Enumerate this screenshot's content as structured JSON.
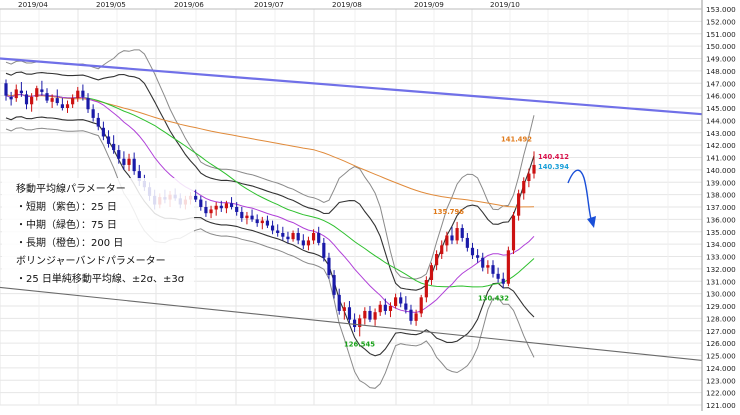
{
  "chart_data": {
    "type": "candlestick",
    "instrument_note": "",
    "x_axis": {
      "labels": [
        "2019/04",
        "2019/05",
        "2019/06",
        "2019/07",
        "2019/08",
        "2019/09",
        "2019/10"
      ]
    },
    "y_axis": {
      "range": [
        121.0,
        153.0
      ],
      "tick_step": 1.0,
      "tick_labels": [
        "153.000",
        "152.000",
        "151.000",
        "150.000",
        "149.000",
        "148.000",
        "147.000",
        "146.000",
        "145.000",
        "144.000",
        "143.000",
        "142.000",
        "141.000",
        "140.000",
        "139.000",
        "138.000",
        "137.000",
        "136.000",
        "135.000",
        "134.000",
        "133.000",
        "132.000",
        "131.000",
        "130.000",
        "129.000",
        "128.000",
        "127.000",
        "126.000",
        "125.000",
        "124.000",
        "123.000",
        "122.000",
        "121.000"
      ],
      "grid": true
    },
    "legend_text": {
      "ma_title": "移動平均線パラメーター",
      "ma_short": "・短期（紫色）：25 日",
      "ma_mid": "・中期（緑色）：75 日",
      "ma_long": "・長期（橙色）：200 日",
      "bb_title": "ボリンジャーバンドパラメーター",
      "bb_desc": "・25 日単純移動平均線、±2σ、±3σ"
    },
    "annotations": [
      {
        "text": "126.545",
        "price": 126.545,
        "color": "#1aa31a"
      },
      {
        "text": "135.796",
        "price": 135.796,
        "color": "#e07a1a"
      },
      {
        "text": "130.432",
        "price": 130.432,
        "color": "#1aa31a"
      },
      {
        "text": "141.492",
        "price": 141.492,
        "color": "#e07a1a"
      },
      {
        "text": "140.412",
        "price": 140.412,
        "color": "#d8124a"
      },
      {
        "text": "140.394",
        "price": 140.394,
        "color": "#1a9fd8"
      }
    ],
    "series_colors": {
      "up_candle": "#cc1111",
      "down_candle": "#1a1aa8",
      "ma_short": "#b040d8",
      "ma_mid": "#2ec02e",
      "ma_long": "#e08a3a",
      "bb_mid": "#333333",
      "bb_outer": "#8a8a8a",
      "trend_upper": "#7070e8",
      "trend_lower": "#6a6a6a",
      "forecast_arrow": "#1a4fd8"
    },
    "candles": [
      [
        147.0,
        147.3,
        145.6,
        146.0
      ],
      [
        145.9,
        146.3,
        145.2,
        145.7
      ],
      [
        145.8,
        146.9,
        145.5,
        146.5
      ],
      [
        146.4,
        147.1,
        145.9,
        146.2
      ],
      [
        146.1,
        146.4,
        144.9,
        145.3
      ],
      [
        145.3,
        146.2,
        144.7,
        145.9
      ],
      [
        145.9,
        146.8,
        145.6,
        146.6
      ],
      [
        146.5,
        147.2,
        146.0,
        146.3
      ],
      [
        146.2,
        146.6,
        145.4,
        145.6
      ],
      [
        145.5,
        146.1,
        145.0,
        145.8
      ],
      [
        145.8,
        146.5,
        145.2,
        145.4
      ],
      [
        145.3,
        145.8,
        144.8,
        145.0
      ],
      [
        145.0,
        145.6,
        144.6,
        145.3
      ],
      [
        145.3,
        146.1,
        145.0,
        145.8
      ],
      [
        145.8,
        146.7,
        145.5,
        146.4
      ],
      [
        146.4,
        146.9,
        145.6,
        145.9
      ],
      [
        145.8,
        146.2,
        144.6,
        144.9
      ],
      [
        144.9,
        145.3,
        143.9,
        144.2
      ],
      [
        144.2,
        144.6,
        143.2,
        143.5
      ],
      [
        143.4,
        143.9,
        142.4,
        142.7
      ],
      [
        142.7,
        143.2,
        141.8,
        142.1
      ],
      [
        142.1,
        142.8,
        141.3,
        141.6
      ],
      [
        141.6,
        142.0,
        140.5,
        140.9
      ],
      [
        140.9,
        141.5,
        140.0,
        140.4
      ],
      [
        140.4,
        141.3,
        139.9,
        140.9
      ],
      [
        140.9,
        141.4,
        139.6,
        139.9
      ],
      [
        139.9,
        140.4,
        138.7,
        139.1
      ],
      [
        139.1,
        139.6,
        138.3,
        138.6
      ],
      [
        138.6,
        139.0,
        137.5,
        137.9
      ],
      [
        137.9,
        138.4,
        136.8,
        137.2
      ],
      [
        137.2,
        138.1,
        136.9,
        137.8
      ],
      [
        137.8,
        138.4,
        137.3,
        137.6
      ],
      [
        137.6,
        138.3,
        137.0,
        138.0
      ],
      [
        138.0,
        138.5,
        137.5,
        137.7
      ],
      [
        137.7,
        138.1,
        136.9,
        137.2
      ],
      [
        137.2,
        137.9,
        136.8,
        137.6
      ],
      [
        137.6,
        138.2,
        137.2,
        137.9
      ],
      [
        137.9,
        138.4,
        137.4,
        137.6
      ],
      [
        137.6,
        137.9,
        136.7,
        137.0
      ],
      [
        137.0,
        137.5,
        136.2,
        136.5
      ],
      [
        136.5,
        137.1,
        136.1,
        136.8
      ],
      [
        136.8,
        137.4,
        136.3,
        137.1
      ],
      [
        137.1,
        137.5,
        136.6,
        136.9
      ],
      [
        136.9,
        137.5,
        136.5,
        137.3
      ],
      [
        137.3,
        137.8,
        136.8,
        137.0
      ],
      [
        137.0,
        137.4,
        136.3,
        136.6
      ],
      [
        136.6,
        137.0,
        135.8,
        136.1
      ],
      [
        136.1,
        136.6,
        135.6,
        136.3
      ],
      [
        136.3,
        136.8,
        135.8,
        136.0
      ],
      [
        136.0,
        136.4,
        135.4,
        135.7
      ],
      [
        135.7,
        136.2,
        135.2,
        135.9
      ],
      [
        135.9,
        136.3,
        135.3,
        135.5
      ],
      [
        135.5,
        135.9,
        134.8,
        135.1
      ],
      [
        135.1,
        135.6,
        134.6,
        134.9
      ],
      [
        134.9,
        135.4,
        134.3,
        134.6
      ],
      [
        134.6,
        135.0,
        134.1,
        134.4
      ],
      [
        134.4,
        135.1,
        134.2,
        134.9
      ],
      [
        134.9,
        135.3,
        134.0,
        134.3
      ],
      [
        134.3,
        134.8,
        133.6,
        133.9
      ],
      [
        133.9,
        134.6,
        133.5,
        134.3
      ],
      [
        134.3,
        135.2,
        134.0,
        134.9
      ],
      [
        134.9,
        135.4,
        133.9,
        134.1
      ],
      [
        134.1,
        134.5,
        132.6,
        132.9
      ],
      [
        132.9,
        133.3,
        131.2,
        131.5
      ],
      [
        131.5,
        131.9,
        129.6,
        129.9
      ],
      [
        129.9,
        130.4,
        128.3,
        128.6
      ],
      [
        128.6,
        129.3,
        127.9,
        128.9
      ],
      [
        128.9,
        129.4,
        127.6,
        127.9
      ],
      [
        127.9,
        128.4,
        126.9,
        127.3
      ],
      [
        127.3,
        128.3,
        126.545,
        128.0
      ],
      [
        128.0,
        128.9,
        127.5,
        128.6
      ],
      [
        128.6,
        129.0,
        127.7,
        127.9
      ],
      [
        127.9,
        128.8,
        127.4,
        128.5
      ],
      [
        128.5,
        129.4,
        128.2,
        129.1
      ],
      [
        129.1,
        129.6,
        128.3,
        128.6
      ],
      [
        128.6,
        129.3,
        128.1,
        129.0
      ],
      [
        129.0,
        130.0,
        128.8,
        129.7
      ],
      [
        129.7,
        130.1,
        128.9,
        129.2
      ],
      [
        129.2,
        129.8,
        128.4,
        128.7
      ],
      [
        128.7,
        129.1,
        127.5,
        127.8
      ],
      [
        127.8,
        128.7,
        127.4,
        128.4
      ],
      [
        128.4,
        129.9,
        128.1,
        129.7
      ],
      [
        129.7,
        131.4,
        129.3,
        131.1
      ],
      [
        131.1,
        132.5,
        130.7,
        132.3
      ],
      [
        132.3,
        133.5,
        131.9,
        133.2
      ],
      [
        133.2,
        134.3,
        132.8,
        133.9
      ],
      [
        133.9,
        135.0,
        133.4,
        134.7
      ],
      [
        134.7,
        135.4,
        134.0,
        134.3
      ],
      [
        134.3,
        135.796,
        134.0,
        135.3
      ],
      [
        135.3,
        135.6,
        134.2,
        134.5
      ],
      [
        134.5,
        134.9,
        133.4,
        133.7
      ],
      [
        133.7,
        134.1,
        132.8,
        133.1
      ],
      [
        133.1,
        133.6,
        132.5,
        132.9
      ],
      [
        132.9,
        133.3,
        131.8,
        132.1
      ],
      [
        132.1,
        132.7,
        131.6,
        132.3
      ],
      [
        132.3,
        132.7,
        131.3,
        131.6
      ],
      [
        131.6,
        132.1,
        130.9,
        131.2
      ],
      [
        131.2,
        131.7,
        130.432,
        130.8
      ],
      [
        130.8,
        133.8,
        130.6,
        133.5
      ],
      [
        133.5,
        136.6,
        133.2,
        136.3
      ],
      [
        136.3,
        138.4,
        135.9,
        138.1
      ],
      [
        138.1,
        139.4,
        137.6,
        139.1
      ],
      [
        139.1,
        140.1,
        138.6,
        139.7
      ],
      [
        139.7,
        141.492,
        139.3,
        140.4
      ]
    ]
  }
}
